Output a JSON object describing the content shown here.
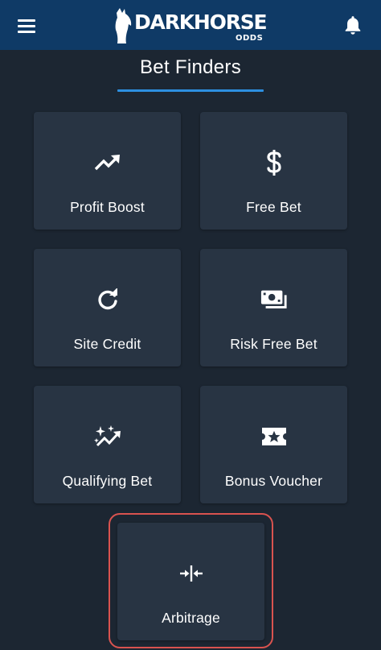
{
  "header": {
    "logo_text": "DARKHORSE",
    "logo_sub": "ODDS",
    "icons": {
      "menu": "hamburger-menu-icon",
      "notifications": "bell-icon",
      "logo": "horse-head-icon"
    }
  },
  "page": {
    "title": "Bet Finders"
  },
  "finders": [
    {
      "label": "Profit Boost",
      "icon": "trending-up-icon"
    },
    {
      "label": "Free Bet",
      "icon": "dollar-sign-icon"
    },
    {
      "label": "Site Credit",
      "icon": "refresh-icon"
    },
    {
      "label": "Risk Free Bet",
      "icon": "money-bill-icon"
    },
    {
      "label": "Qualifying Bet",
      "icon": "sparkles-trend-icon"
    },
    {
      "label": "Bonus Voucher",
      "icon": "ticket-star-icon"
    },
    {
      "label": "Arbitrage",
      "icon": "compress-arrows-icon"
    }
  ],
  "colors": {
    "header_bg": "#0f3a66",
    "page_bg": "#1c2632",
    "card_bg": "#283443",
    "accent": "#2d8fe0",
    "highlight": "#d9534f"
  }
}
